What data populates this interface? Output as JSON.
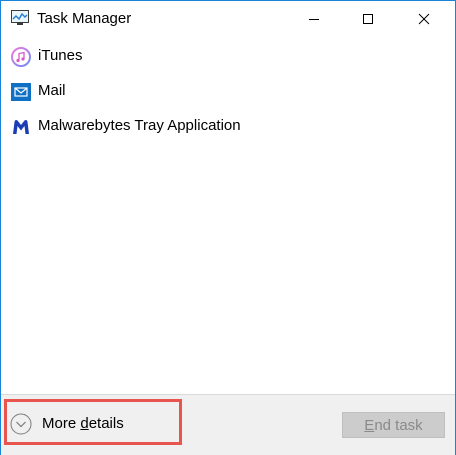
{
  "window": {
    "title": "Task Manager",
    "controls": {
      "minimize": "minimize-icon",
      "maximize": "maximize-icon",
      "close": "close-icon"
    }
  },
  "processes": [
    {
      "label": "iTunes",
      "icon": "itunes-icon"
    },
    {
      "label": "Mail",
      "icon": "mail-icon"
    },
    {
      "label": "Malwarebytes Tray Application",
      "icon": "malwarebytes-icon"
    }
  ],
  "footer": {
    "more_details_prefix": "More ",
    "more_details_underlined": "d",
    "more_details_suffix": "etails",
    "end_task_prefix": "",
    "end_task_underlined": "E",
    "end_task_suffix": "nd task",
    "end_task_disabled": true,
    "highlight_color": "#e8554e"
  },
  "colors": {
    "window_border": "#1883d7",
    "footer_bg": "#f0f0f0"
  }
}
